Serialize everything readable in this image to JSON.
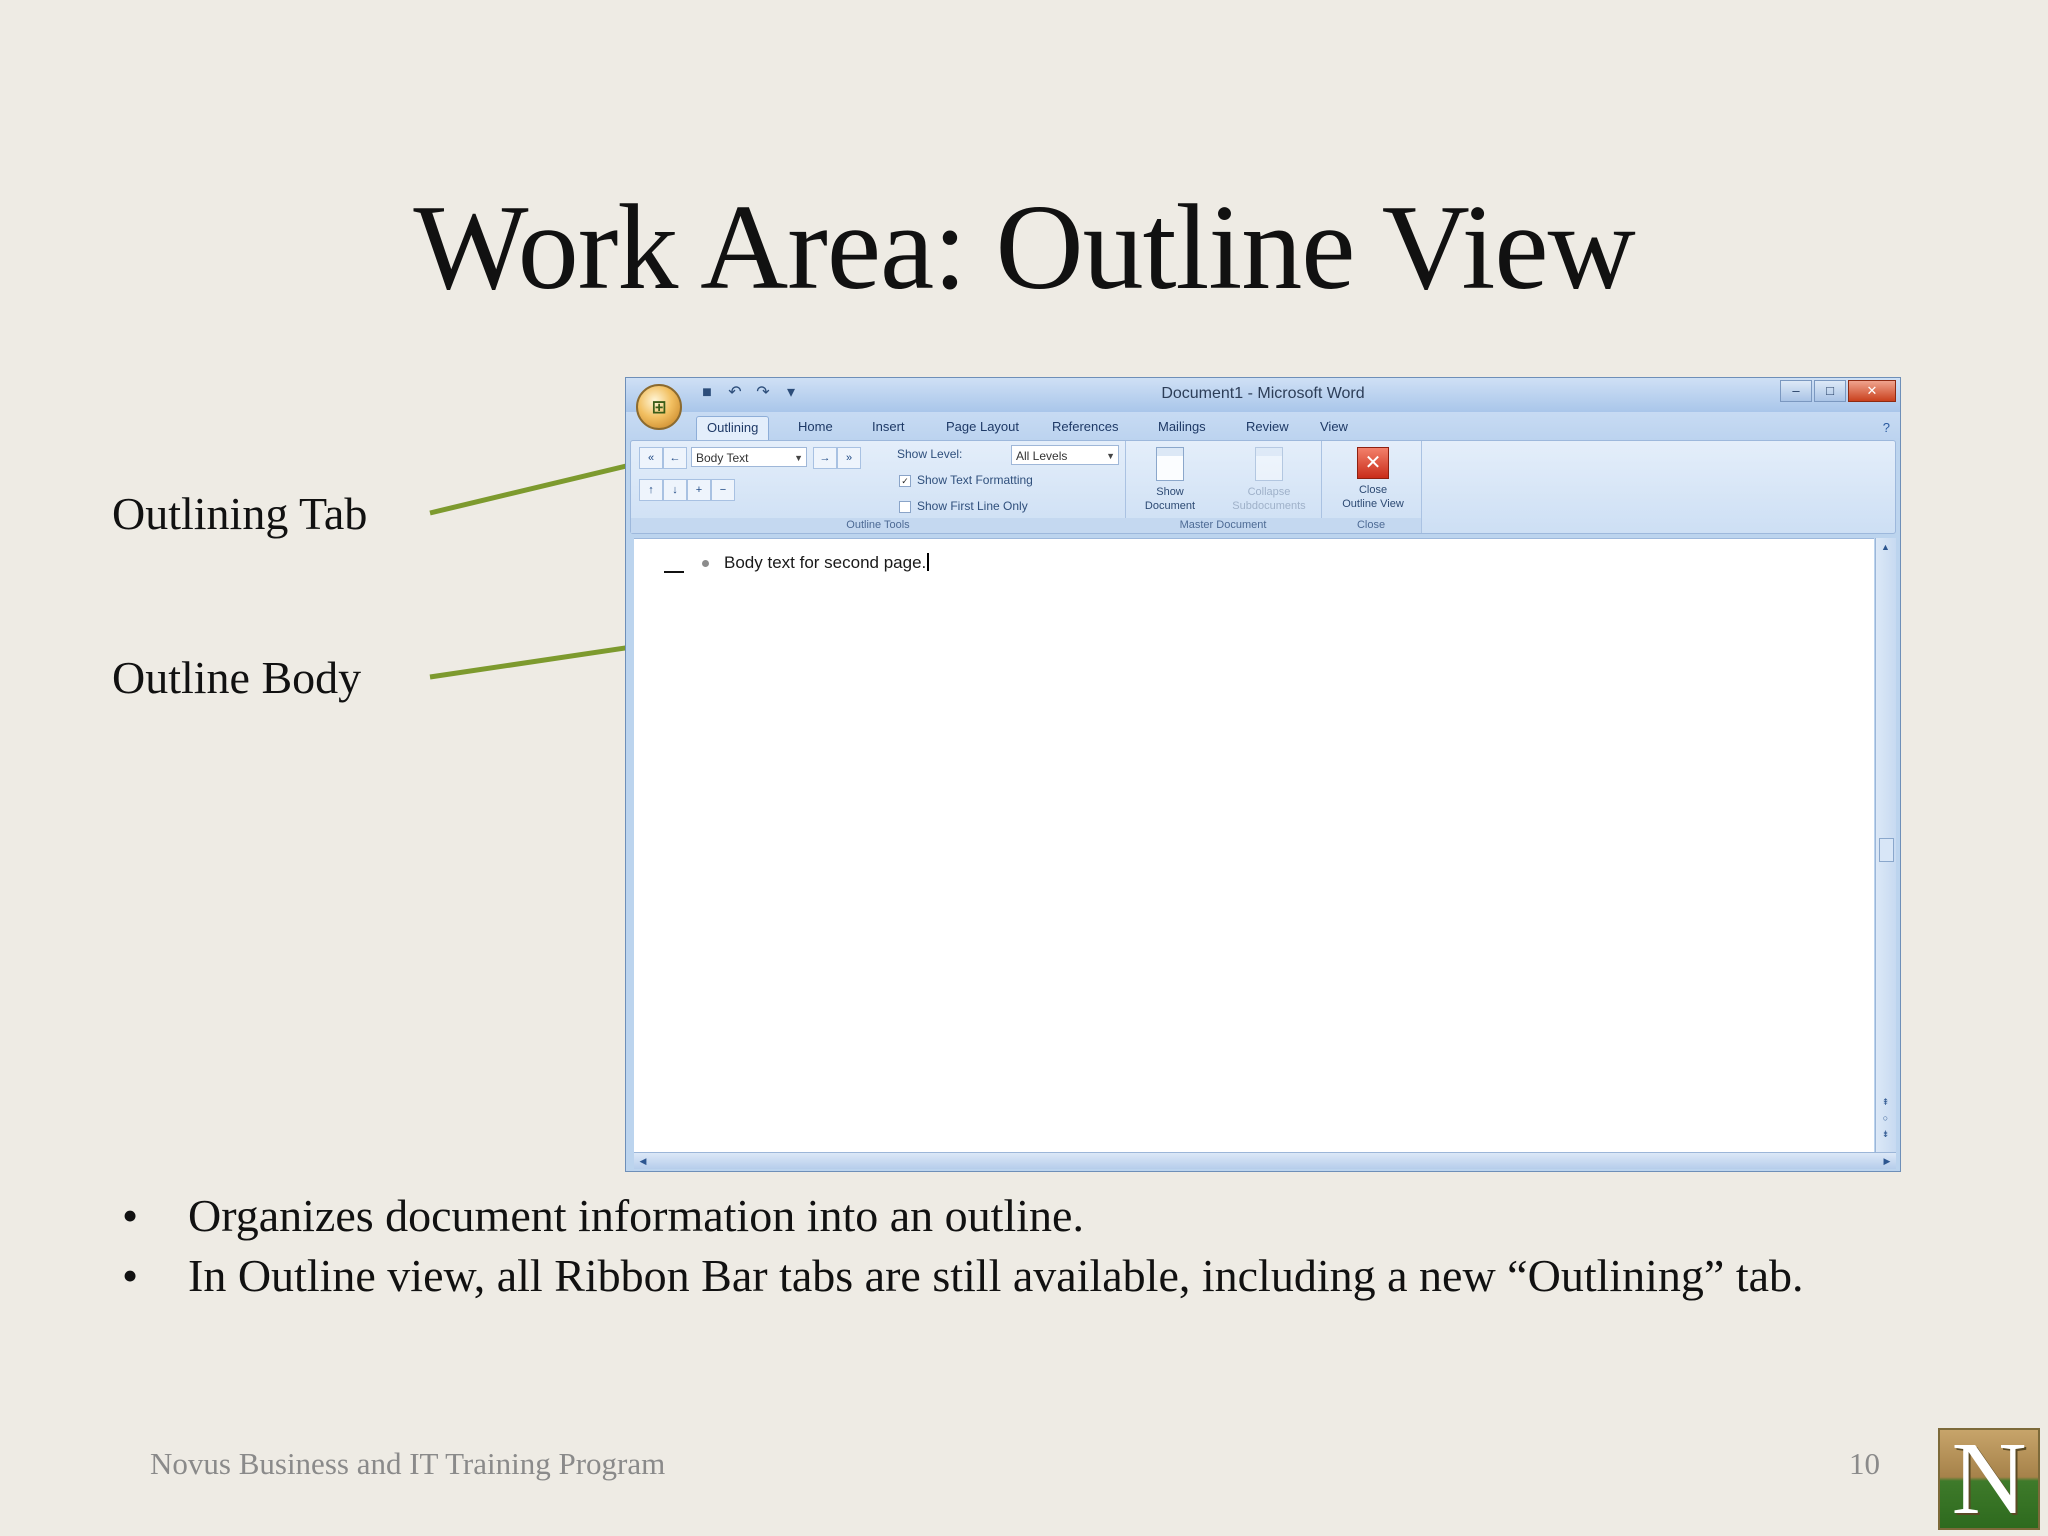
{
  "slide": {
    "title": "Work Area: Outline View",
    "callouts": {
      "outlining_tab": "Outlining Tab",
      "outline_body": "Outline Body"
    },
    "bullets": [
      "Organizes document information into an outline.",
      "In Outline view, all Ribbon Bar tabs are still available, including a new “Outlining” tab."
    ],
    "footer": "Novus Business and IT Training Program",
    "page_number": "10",
    "logo_letter": "N",
    "arrow_color": "#7d9a2e"
  },
  "word": {
    "window_title": "Document1 - Microsoft Word",
    "tabs": [
      "Outlining",
      "Home",
      "Insert",
      "Page Layout",
      "References",
      "Mailings",
      "Review",
      "View"
    ],
    "active_tab": "Outlining",
    "ribbon": {
      "outline_tools": {
        "label": "Outline Tools",
        "level_combo_value": "Body Text",
        "show_level_label": "Show Level:",
        "show_level_value": "All Levels",
        "show_text_formatting": "Show Text Formatting",
        "show_text_formatting_checked": true,
        "show_first_line_only": "Show First Line Only",
        "show_first_line_only_checked": false
      },
      "master_document": {
        "label": "Master Document",
        "show_document_line1": "Show",
        "show_document_line2": "Document",
        "collapse_subdocuments_line1": "Collapse",
        "collapse_subdocuments_line2": "Subdocuments"
      },
      "close": {
        "label": "Close",
        "close_outline_line1": "Close",
        "close_outline_line2": "Outline View"
      }
    },
    "document": {
      "outline_text": "Body text for second page."
    }
  }
}
